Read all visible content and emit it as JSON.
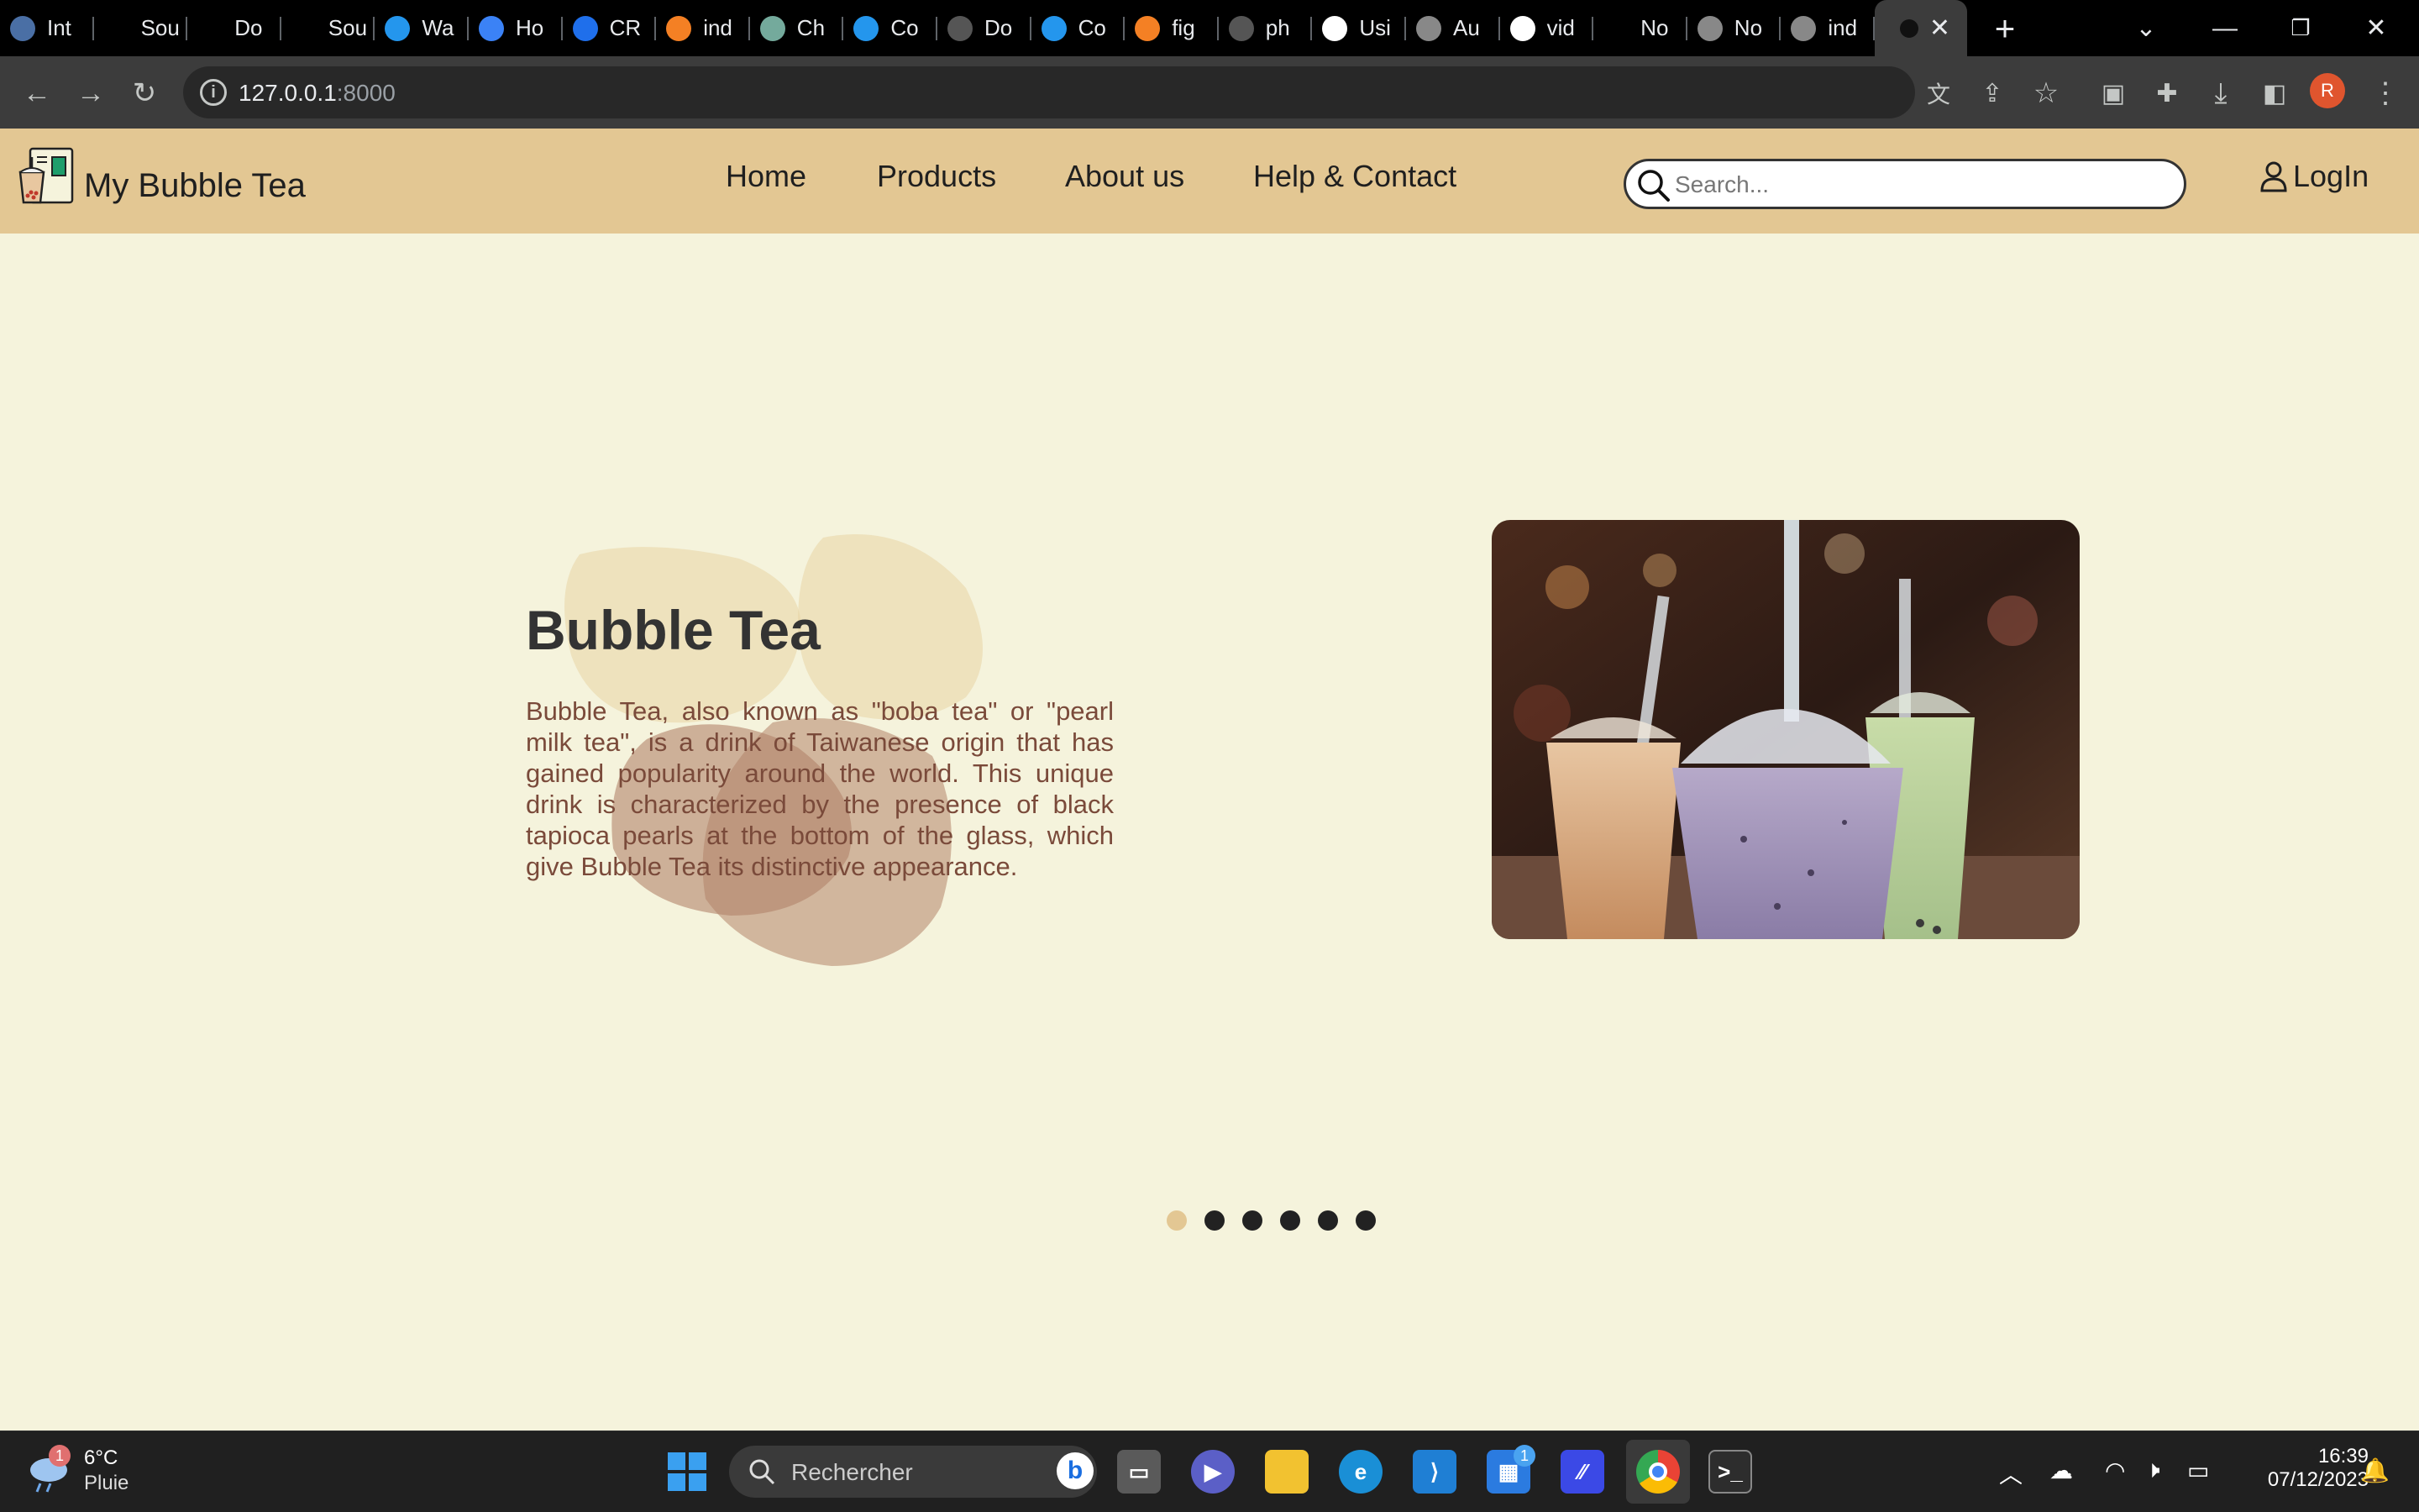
{
  "browser": {
    "tabs": [
      {
        "label": "Int",
        "icon": "chart-favicon",
        "color": "#4a6fa5"
      },
      {
        "label": "Sou",
        "icon": "github-favicon",
        "color": "#000"
      },
      {
        "label": "Do",
        "icon": "medium-favicon",
        "color": "#000"
      },
      {
        "label": "Sou",
        "icon": "github-favicon",
        "color": "#000"
      },
      {
        "label": "Wa",
        "icon": "docker-favicon",
        "color": "#2496ed"
      },
      {
        "label": "Ho",
        "icon": "spinner-favicon",
        "color": "#3b82f6"
      },
      {
        "label": "CR",
        "icon": "bird-favicon",
        "color": "#1f6feb"
      },
      {
        "label": "ind",
        "icon": "stackoverflow-favicon",
        "color": "#f48024"
      },
      {
        "label": "Ch",
        "icon": "chatgpt-favicon",
        "color": "#74aa9c"
      },
      {
        "label": "Co",
        "icon": "docker-favicon",
        "color": "#2496ed"
      },
      {
        "label": "Do",
        "icon": "docker-favicon",
        "color": "#555"
      },
      {
        "label": "Co",
        "icon": "docker-favicon",
        "color": "#2496ed"
      },
      {
        "label": "fig",
        "icon": "stackoverflow-favicon",
        "color": "#f48024"
      },
      {
        "label": "ph",
        "icon": "docker-favicon",
        "color": "#555"
      },
      {
        "label": "Usi",
        "icon": "wordpress-favicon",
        "color": "#fff"
      },
      {
        "label": "Au",
        "icon": "globe-favicon",
        "color": "#888"
      },
      {
        "label": "vid",
        "icon": "google-favicon",
        "color": "#fff"
      },
      {
        "label": "No",
        "icon": "medium-favicon",
        "color": "#000"
      },
      {
        "label": "No",
        "icon": "chrome-favicon",
        "color": "#888"
      },
      {
        "label": "ind",
        "icon": "globe-favicon",
        "color": "#888"
      }
    ],
    "url_host": "127.0.0.1",
    "url_port": ":8000",
    "profile_initial": "R"
  },
  "site": {
    "brand": "My Bubble Tea",
    "nav": {
      "home": "Home",
      "products": "Products",
      "about": "About us",
      "help": "Help & Contact"
    },
    "search_placeholder": "Search...",
    "login": "LogIn"
  },
  "hero": {
    "title": "Bubble Tea",
    "text": "Bubble Tea, also known as \"boba tea\" or \"pearl milk tea\", is a drink of Taiwanese origin that has gained popularity around the world. This unique drink is characterized by the presence of black tapioca pearls at the bottom of the glass, which give Bubble Tea its distinctive appearance.",
    "image": "bubble-tea-cups-photo",
    "slides_total": 6,
    "active_slide": 1
  },
  "colors": {
    "header": "#e3c793",
    "page_bg": "#f5f3dc",
    "accent_dot": "#e3c793",
    "text_brown": "#7a4a3a"
  },
  "taskbar": {
    "weather_temp": "6°C",
    "weather_cond": "Pluie",
    "weather_badge": "1",
    "search_label": "Rechercher",
    "store_badge": "1",
    "time": "16:39",
    "date": "07/12/2023"
  }
}
